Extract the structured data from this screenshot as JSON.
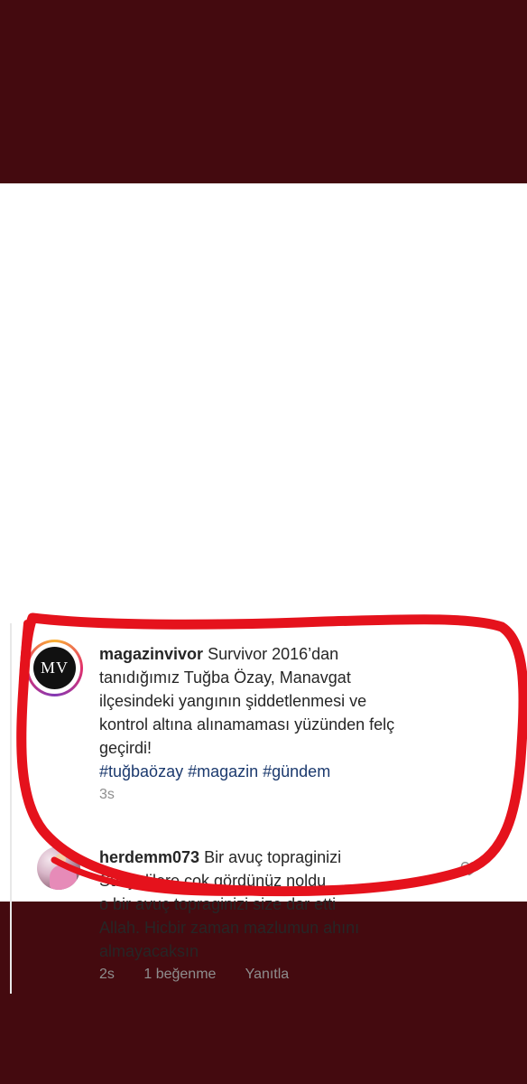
{
  "post": {
    "author": "magazinvivor",
    "avatar_initials": "MV",
    "caption_lines": [
      "Survivor 2016’dan",
      "tanıdığımız Tuğba Özay, Manavgat",
      "ilçesindeki yangının şiddetlenmesi ve",
      "kontrol altına alınamaması yüzünden felç",
      "geçirdi!"
    ],
    "hashtags": "#tuğbaözay #magazin #gündem",
    "time": "3s"
  },
  "reply": {
    "author": "herdemm073",
    "text_lines": [
      "Bir avuç topraginizi",
      "Suriyelilere çok gördünüz noldu",
      "o bir avuç topraginizi size dar etti",
      "Allah. Hicbir zaman mazlumun ahını",
      "almayacaksın"
    ],
    "time": "2s",
    "likes": "1 beğenme",
    "reply_label": "Yanıtla"
  },
  "colors": {
    "background_frame": "#440a0f",
    "annotation": "#e5121c",
    "hashtag": "#1c3a6e",
    "meta": "#8e8e8e"
  }
}
